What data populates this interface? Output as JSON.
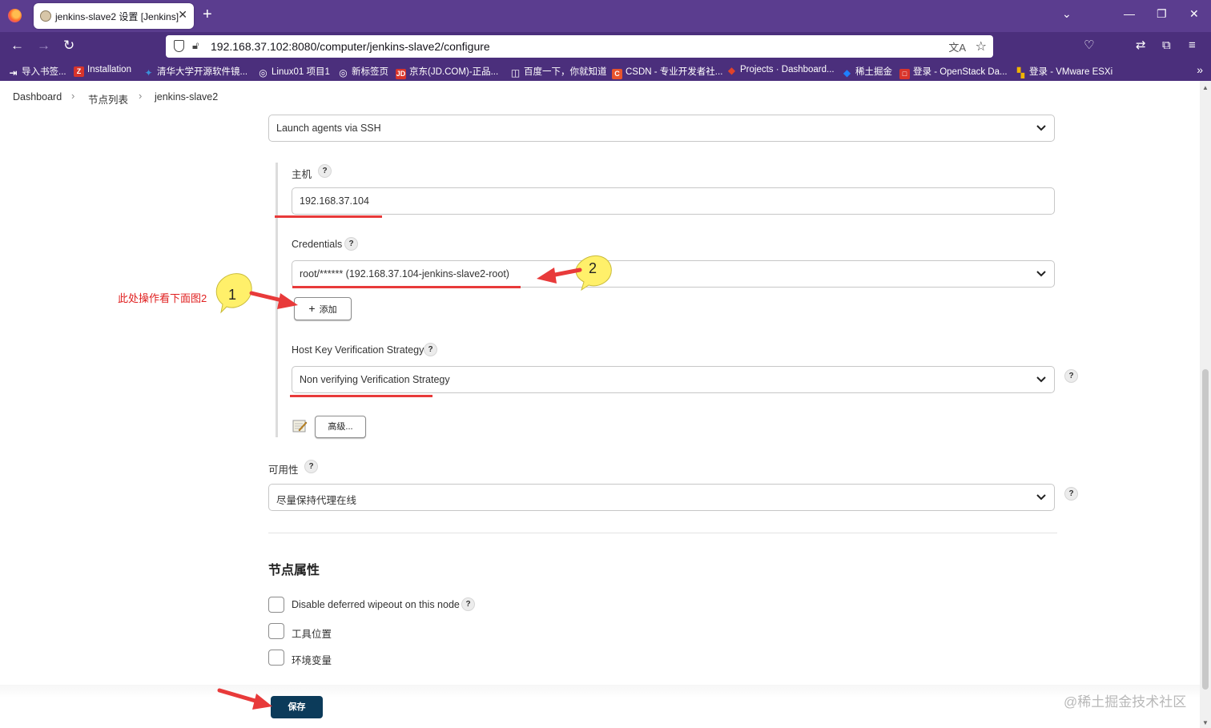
{
  "browser": {
    "tab_title": "jenkins-slave2 设置 [Jenkins]",
    "tab_close": "✕",
    "new_tab": "+",
    "url": "192.168.37.102:8080/computer/jenkins-slave2/configure",
    "bookmarks": [
      {
        "label": "导入书签...",
        "icon": "import-icon",
        "color": "#ffffff"
      },
      {
        "label": "Installation",
        "icon": "z-icon",
        "color": "#d9342b"
      },
      {
        "label": "清华大学开源软件镜...",
        "icon": "tsinghua-icon",
        "color": "#3b8fd8"
      },
      {
        "label": "Linux01 项目1",
        "icon": "globe-icon",
        "color": "#ffffff"
      },
      {
        "label": "新标签页",
        "icon": "globe-icon",
        "color": "#ffffff"
      },
      {
        "label": "京东(JD.COM)-正品...",
        "icon": "jd-icon",
        "color": "#d9342b"
      },
      {
        "label": "百度一下，你就知道",
        "icon": "baidu-icon",
        "color": "#ffffff"
      },
      {
        "label": "CSDN - 专业开发者社...",
        "icon": "csdn-icon",
        "color": "#e8542c"
      },
      {
        "label": "Projects · Dashboard...",
        "icon": "gitlab-icon",
        "color": "#e24329"
      },
      {
        "label": "稀土掘金",
        "icon": "juejin-icon",
        "color": "#1e80ff"
      },
      {
        "label": "登录 - OpenStack Da...",
        "icon": "openstack-icon",
        "color": "#d9342b"
      },
      {
        "label": "登录 - VMware ESXi",
        "icon": "vmware-icon",
        "color": "#f0b400"
      }
    ]
  },
  "breadcrumb": {
    "items": [
      "Dashboard",
      "节点列表",
      "jenkins-slave2"
    ]
  },
  "form": {
    "launch_method": "Launch agents via SSH",
    "host_label": "主机",
    "host_value": "192.168.37.104",
    "credentials_label": "Credentials",
    "credentials_value": "root/****** (192.168.37.104-jenkins-slave2-root)",
    "add_button": "添加",
    "host_key_label": "Host Key Verification Strategy",
    "host_key_value": "Non verifying Verification Strategy",
    "advanced_button": "高级...",
    "availability_label": "可用性",
    "availability_value": "尽量保持代理在线",
    "help_glyph": "?"
  },
  "node_properties": {
    "title": "节点属性",
    "options": [
      {
        "label": "Disable deferred wipeout on this node",
        "checked": false
      },
      {
        "label": "工具位置",
        "checked": false
      },
      {
        "label": "环境变量",
        "checked": false
      }
    ]
  },
  "save_button": "保存",
  "annotations": {
    "note": "此处操作看下面图2",
    "badge_1": "1",
    "badge_2": "2",
    "accent_red": "#e83a3a",
    "badge_yellow": "#fff06a"
  },
  "watermark": "@稀土掘金技术社区"
}
